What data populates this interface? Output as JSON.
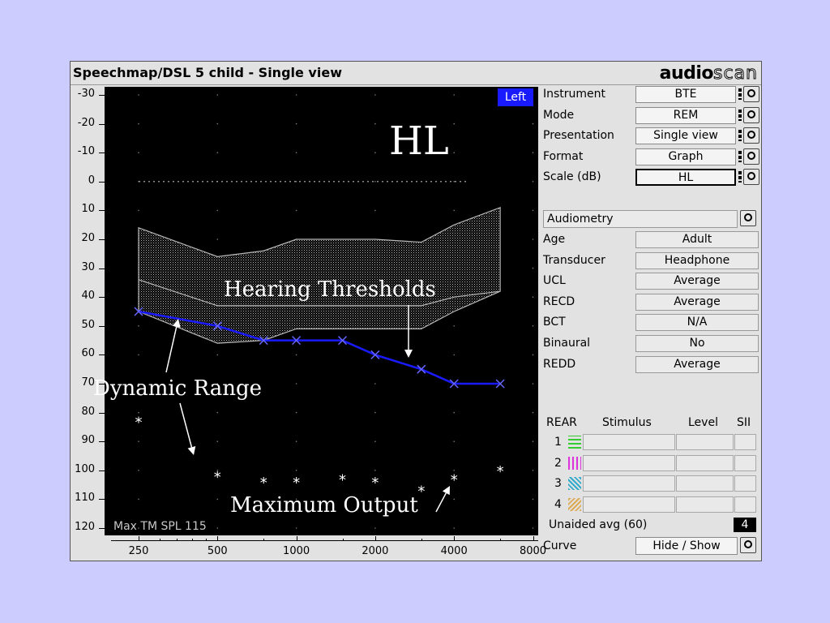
{
  "window": {
    "title": "Speechmap/DSL 5 child - Single view",
    "logo_bold": "audio",
    "logo_light": "scan"
  },
  "plot": {
    "ear_tag": "Left",
    "overlay_big": "HL",
    "footer": "Max TM SPL 115",
    "annotations": {
      "hearing": "Hearing Thresholds",
      "dynamic": "Dynamic Range",
      "maxout": "Maximum Output"
    },
    "y_ticks": [
      "-30",
      "-20",
      "-10",
      "0",
      "10",
      "20",
      "30",
      "40",
      "50",
      "60",
      "70",
      "80",
      "90",
      "100",
      "110",
      "120"
    ],
    "x_ticks": [
      "250",
      "500",
      "1000",
      "2000",
      "4000",
      "8000"
    ]
  },
  "chart_data": {
    "type": "line",
    "scale": "HL",
    "y_unit": "dB HL",
    "y_range": [
      -30,
      120
    ],
    "y_inverted": true,
    "x_unit": "Hz",
    "x_log": true,
    "x_range": [
      200,
      8000
    ],
    "reference_line": {
      "y": 0,
      "style": "dotted"
    },
    "dynamic_range_band": {
      "frequencies": [
        250,
        500,
        750,
        1000,
        1500,
        2000,
        3000,
        4000,
        6000
      ],
      "upper": [
        16,
        26,
        24,
        20,
        20,
        20,
        21,
        15,
        9
      ],
      "lower": [
        34,
        43,
        43,
        43,
        43,
        43,
        43,
        40,
        38
      ],
      "lower_outer": [
        45,
        56,
        55,
        51,
        51,
        51,
        51,
        45,
        38
      ]
    },
    "series": [
      {
        "frequencies": [
          250,
          500,
          750,
          1000,
          1500,
          2000,
          3000,
          4000,
          6000
        ],
        "values": [
          45,
          50,
          55,
          55,
          55,
          60,
          65,
          70,
          70
        ],
        "color": "#1a1aff"
      },
      {
        "frequencies": [
          250,
          500,
          750,
          1000,
          1500,
          2000,
          3000,
          4000,
          6000
        ],
        "values": [
          83,
          102,
          104,
          104,
          103,
          104,
          107,
          103,
          100
        ],
        "color": "#ffffff",
        "marker": "*"
      }
    ]
  },
  "panel": {
    "settings": [
      {
        "label": "Instrument",
        "value": "BTE"
      },
      {
        "label": "Mode",
        "value": "REM"
      },
      {
        "label": "Presentation",
        "value": "Single view"
      },
      {
        "label": "Format",
        "value": "Graph"
      },
      {
        "label": "Scale (dB)",
        "value": "HL"
      }
    ],
    "audiometry_button": "Audiometry",
    "audiometry": [
      {
        "label": "Age",
        "value": "Adult"
      },
      {
        "label": "Transducer",
        "value": "Headphone"
      },
      {
        "label": "UCL",
        "value": "Average"
      },
      {
        "label": "RECD",
        "value": "Average"
      },
      {
        "label": "BCT",
        "value": "N/A"
      },
      {
        "label": "Binaural",
        "value": "No"
      },
      {
        "label": "REDD",
        "value": "Average"
      }
    ],
    "rear_headers": {
      "rear": "REAR",
      "stimulus": "Stimulus",
      "level": "Level",
      "sii": "SII"
    },
    "rear_rows": [
      {
        "n": "1",
        "color": "#33cc33"
      },
      {
        "n": "2",
        "color": "#dd33dd"
      },
      {
        "n": "3",
        "color": "#33aacc"
      },
      {
        "n": "4",
        "color": "#ddaa55"
      }
    ],
    "unaided_label": "Unaided avg (60)",
    "unaided_value": "4",
    "curve_label": "Curve",
    "curve_value": "Hide / Show"
  }
}
